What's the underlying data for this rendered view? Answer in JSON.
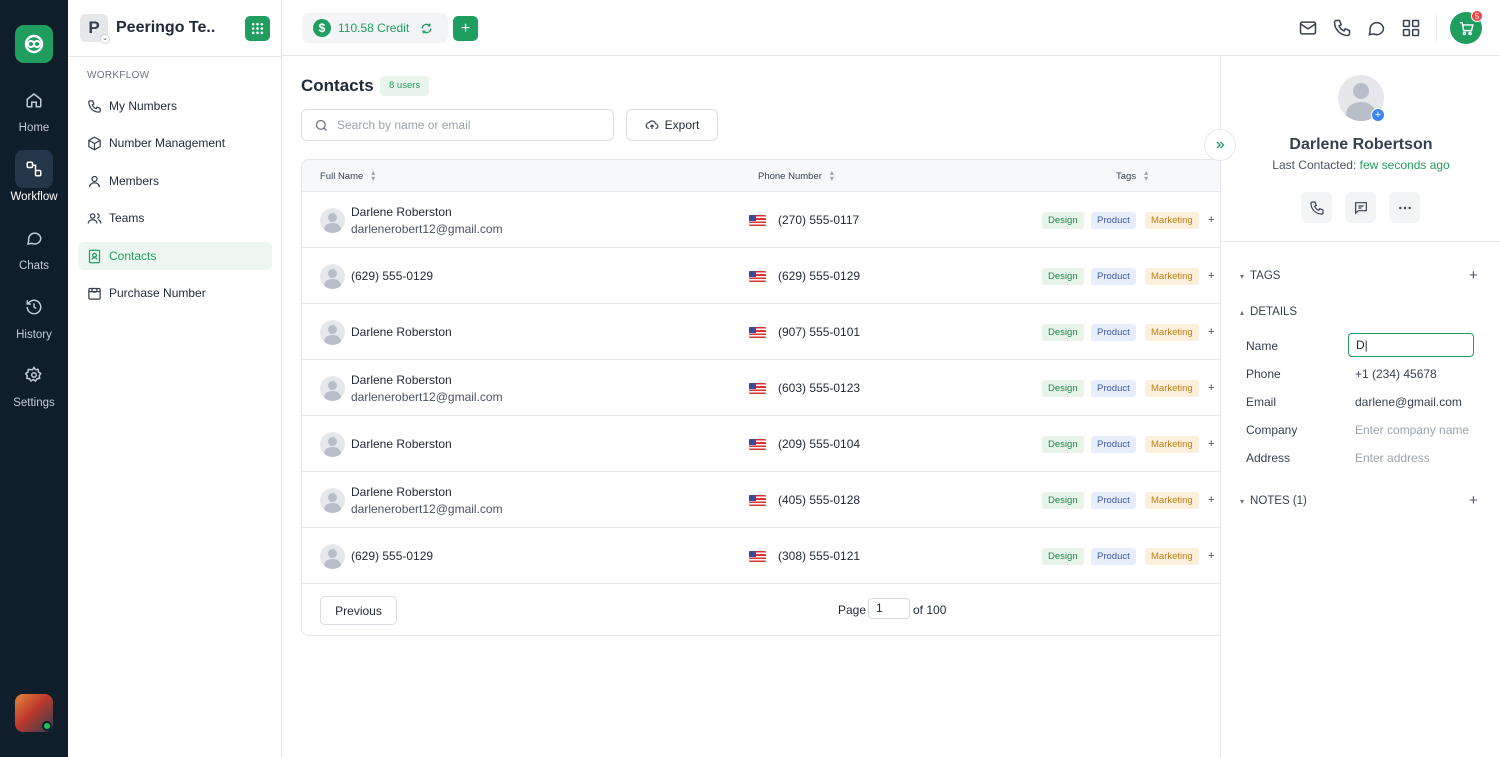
{
  "rail": {
    "items": [
      {
        "label": "Home",
        "icon": "home-icon"
      },
      {
        "label": "Workflow",
        "icon": "workflow-icon",
        "active": true
      },
      {
        "label": "Chats",
        "icon": "chat-icon"
      },
      {
        "label": "History",
        "icon": "history-icon"
      },
      {
        "label": "Settings",
        "icon": "gear-icon"
      }
    ]
  },
  "workspace": {
    "initial": "P",
    "name": "Peeringo Te..."
  },
  "sidebar": {
    "section_title": "WORKFLOW",
    "items": [
      {
        "label": "My Numbers",
        "icon": "phone-icon"
      },
      {
        "label": "Number Management",
        "icon": "cube-icon"
      },
      {
        "label": "Members",
        "icon": "user-icon"
      },
      {
        "label": "Teams",
        "icon": "team-icon"
      },
      {
        "label": "Contacts",
        "icon": "contact-book-icon",
        "active": true
      },
      {
        "label": "Purchase Number",
        "icon": "shopping-bag-icon"
      }
    ]
  },
  "topbar": {
    "credit_label": "110.58 Credit",
    "cart_count": "5"
  },
  "contacts": {
    "title": "Contacts",
    "users_badge": "8 users",
    "search_placeholder": "Search by name or email",
    "export_label": "Export",
    "columns": [
      "Full Name",
      "Phone Number",
      "Tags"
    ],
    "rows": [
      {
        "name": "Darlene Roberston",
        "email": "darlenerobert12@gmail.com",
        "phone": "(270) 555-0117",
        "tags": [
          "Design",
          "Product",
          "Marketing",
          "+"
        ]
      },
      {
        "name": "(629) 555-0129",
        "email": "",
        "phone": "(629) 555-0129",
        "tags": [
          "Design",
          "Product",
          "Marketing",
          "+"
        ]
      },
      {
        "name": "Darlene Roberston",
        "email": "",
        "phone": "(907) 555-0101",
        "tags": [
          "Design",
          "Product",
          "Marketing",
          "+"
        ]
      },
      {
        "name": "Darlene Roberston",
        "email": "darlenerobert12@gmail.com",
        "phone": "(603) 555-0123",
        "tags": [
          "Design",
          "Product",
          "Marketing",
          "+"
        ]
      },
      {
        "name": "Darlene Roberston",
        "email": "",
        "phone": "(209) 555-0104",
        "tags": [
          "Design",
          "Product",
          "Marketing",
          "+"
        ]
      },
      {
        "name": "Darlene Roberston",
        "email": "darlenerobert12@gmail.com",
        "phone": "(405) 555-0128",
        "tags": [
          "Design",
          "Product",
          "Marketing",
          "+"
        ]
      },
      {
        "name": "(629) 555-0129",
        "email": "",
        "phone": "(308) 555-0121",
        "tags": [
          "Design",
          "Product",
          "Marketing",
          "+"
        ]
      }
    ],
    "pager": {
      "previous_label": "Previous",
      "page_label": "Page",
      "page_value": "1",
      "of_label": "of 100"
    }
  },
  "panel": {
    "name": "Darlene Robertson",
    "last_contacted_label": "Last Contacted:",
    "last_contacted_value": "few seconds ago",
    "tags_title": "TAGS",
    "details_title": "DETAILS",
    "notes_title": "NOTES (1)",
    "details": [
      {
        "label": "Name",
        "value": "D|",
        "editing": true
      },
      {
        "label": "Phone",
        "value": "+1 (234) 45678"
      },
      {
        "label": "Email",
        "value": "darlene@gmail.com"
      },
      {
        "label": "Company",
        "value": "Enter company name",
        "placeholder": true
      },
      {
        "label": "Address",
        "value": "Enter address",
        "placeholder": true
      }
    ]
  },
  "colors": {
    "accent": "#1f9e5f",
    "rail_bg": "#101d2b"
  }
}
